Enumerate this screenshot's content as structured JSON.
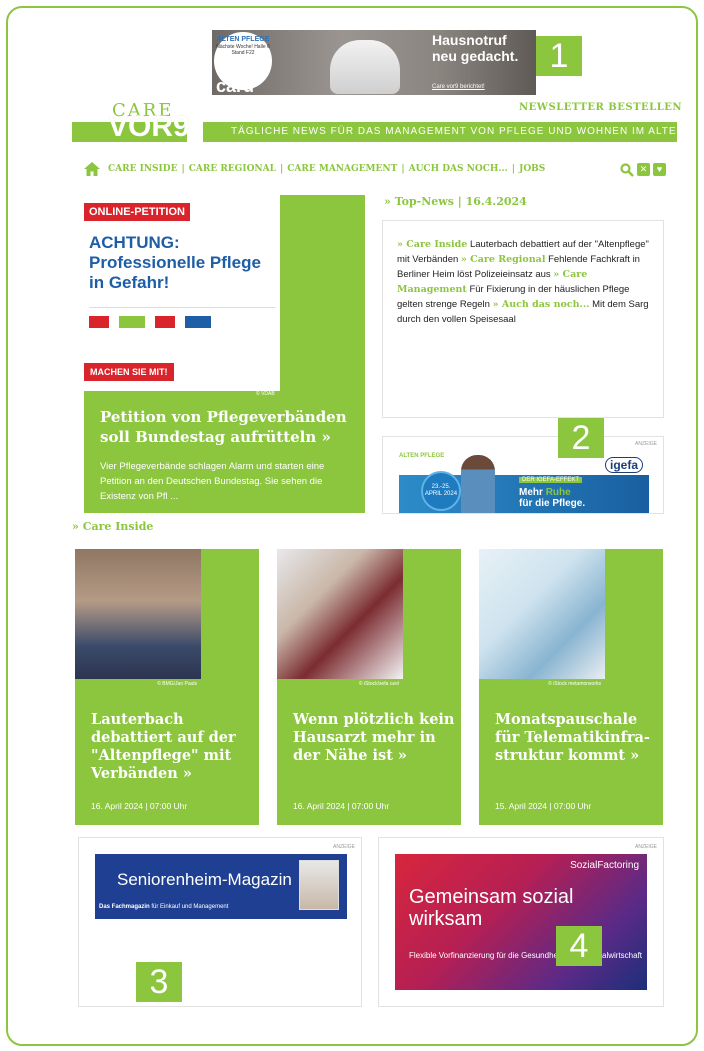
{
  "top_ad": {
    "brand_name": "ALTEN PFLEGE",
    "fair_info": "Nächste Woche! Halle 6 Stand F22",
    "advertiser": "caru",
    "headline": "Hausnotruf neu gedacht.",
    "sub": "Care vor9 berichtet!",
    "badge": "1"
  },
  "header": {
    "brand_top": "CARE",
    "brand_bottom_a": "VOR",
    "brand_bottom_b": "9",
    "tagline": "TÄGLICHE NEWS FÜR DAS MANAGEMENT VON PFLEGE UND WOHNEN IM ALTER",
    "newsletter": "NEWSLETTER BESTELLEN"
  },
  "nav": {
    "items": [
      "CARE INSIDE",
      "CARE REGIONAL",
      "CARE MANAGEMENT",
      "AUCH DAS NOCH...",
      "JOBS"
    ],
    "separator": "|",
    "icons": [
      "home-icon",
      "search-icon",
      "xing-icon",
      "twitter-icon"
    ]
  },
  "feature": {
    "tag": "ONLINE-PETITION",
    "image_heading": "ACHTUNG: Professionelle Pflege in Gefahr!",
    "cta": "MACHEN SIE MIT!",
    "credit": "© VDAB",
    "title": "Petition von Pflegeverbänden soll Bundestag aufrütteln",
    "arrow": "»",
    "teaser": "Vier Pflegeverbände schlagen Alarm und starten eine Petition an den Deutschen Bundestag. Sie sehen die Existenz von Pfl ..."
  },
  "top_news": {
    "heading": "» Top-News | 16.4.2024",
    "entries": [
      {
        "category": "» Care Inside",
        "text": "Lauterbach debattiert auf der \"Altenpflege\" mit Verbänden"
      },
      {
        "category": "» Care Regional",
        "text": "Fehlende Fachkraft in Berliner Heim löst Polizeieinsatz aus"
      },
      {
        "category": "» Care Management",
        "text": "Für Fixierung in der häuslichen Pflege gelten strenge Regeln"
      },
      {
        "category": "» Auch das noch...",
        "text": "Mit dem Sarg durch den vollen Speisesaal"
      }
    ]
  },
  "ad2": {
    "label": "ANZEIGE",
    "brand": "ALTEN PFLEGE",
    "dates": "23.-25. APRIL 2024",
    "advertiser": "igefa",
    "effect": "DER IGEFA-EFFEKT",
    "slogan_a": "Mehr",
    "slogan_b": "Ruhe",
    "slogan_c": "für die Pflege.",
    "badge": "2"
  },
  "care_inside": {
    "heading": "» Care Inside",
    "cards": [
      {
        "credit": "© BMG/Jan Pauls",
        "title": "Lauterbach debattiert auf der \"Altenpflege\" mit Verbänden »",
        "date": "16. April 2024 | 07:00 Uhr"
      },
      {
        "credit": "© iStock/sefa ozel",
        "title": "Wenn plötzlich kein Hausarzt mehr in der Nähe ist »",
        "date": "16. April 2024 | 07:00 Uhr"
      },
      {
        "credit": "© iStock metamorworks",
        "title": "Monatspauschale für Telematikinfra-struktur kommt »",
        "date": "15. April 2024 | 07:00 Uhr"
      }
    ]
  },
  "ad3": {
    "label": "ANZEIGE",
    "title": "Seniorenheim-Magazin",
    "sub_bold": "Das Fachmagazin",
    "sub_rest": "für Einkauf und Management",
    "badge": "3"
  },
  "ad4": {
    "label": "ANZEIGE",
    "brand": "SozialFactoring",
    "big": "Gemeinsam sozial wirksam",
    "small": "Flexible Vorfinanzierung für die Gesundheits- und Sozialwirtschaft",
    "badge": "4"
  }
}
